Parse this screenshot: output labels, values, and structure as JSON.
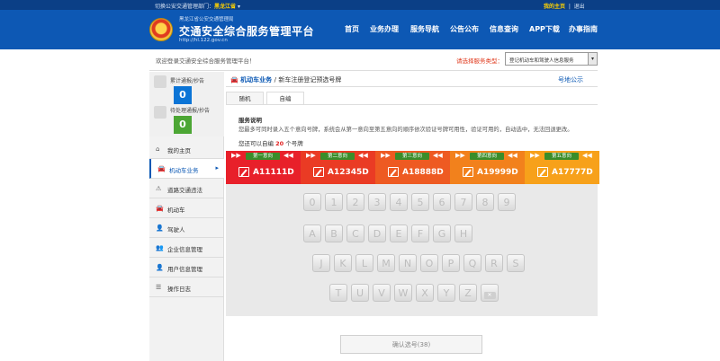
{
  "topbar": {
    "switch_text": "切换公安交通管理部门",
    "province": "黑龙江省",
    "login_link": "我的主页",
    "logout": "退出"
  },
  "header": {
    "bureau": "黑龙江省公安交通管理局",
    "title": "交通安全综合服务管理平台",
    "url": "http://hl.122.gov.cn",
    "nav": [
      "首页",
      "业务办理",
      "服务导航",
      "公告公布",
      "信息查询",
      "APP下载",
      "办事指南"
    ]
  },
  "welcome": {
    "text": "欢迎登录交通安全综合服务管理平台！",
    "service_label": "请选择服务类型：",
    "service_value": "登记机动车和驾驶人信息服务"
  },
  "stats": [
    {
      "label": "累计通报/抄告",
      "value": "0"
    },
    {
      "label": "待处理通报/抄告",
      "value": "0"
    }
  ],
  "sidebar": {
    "items": [
      {
        "label": "我的主页",
        "icon": "home-icon"
      },
      {
        "label": "机动车业务",
        "icon": "car-icon",
        "active": true
      },
      {
        "label": "道路交通违法",
        "icon": "warning-icon"
      },
      {
        "label": "机动车",
        "icon": "car-icon"
      },
      {
        "label": "驾驶人",
        "icon": "person-icon"
      },
      {
        "label": "企业信息管理",
        "icon": "users-icon"
      },
      {
        "label": "用户信息管理",
        "icon": "user-icon"
      },
      {
        "label": "操作日志",
        "icon": "log-icon"
      }
    ]
  },
  "breadcrumb": {
    "section": "机动车业务",
    "separator": "/",
    "page": "新车注册登记预选号牌",
    "help": "号地公示"
  },
  "tabs": [
    {
      "label": "随机"
    },
    {
      "label": "自编",
      "active": true
    }
  ],
  "description": {
    "title": "服务说明",
    "text": "您最多可同时录入五个意向号牌，系统会从第一意向至第五意向的顺序依次验证号牌可用性，验证可用的，自动选中，无法回退更改。",
    "remain_prefix": "您还可以自编",
    "remain_count": "20",
    "remain_suffix": "个号牌"
  },
  "plates": [
    {
      "label": "第一意向",
      "number": "A11111D",
      "color": "#e8202a"
    },
    {
      "label": "第二意向",
      "number": "A12345D",
      "color": "#ea3b24"
    },
    {
      "label": "第三意向",
      "number": "A18888D",
      "color": "#ee5a22"
    },
    {
      "label": "第四意向",
      "number": "A19999D",
      "color": "#f2811c"
    },
    {
      "label": "第五意向",
      "number": "A17777D",
      "color": "#f7a11a"
    }
  ],
  "keyboard": {
    "row1": [
      "0",
      "1",
      "2",
      "3",
      "4",
      "5",
      "6",
      "7",
      "8",
      "9"
    ],
    "row2": [
      "A",
      "B",
      "C",
      "D",
      "E",
      "F",
      "G",
      "H"
    ],
    "row3": [
      "J",
      "K",
      "L",
      "M",
      "N",
      "O",
      "P",
      "Q",
      "R",
      "S"
    ],
    "row4": [
      "T",
      "U",
      "V",
      "W",
      "X",
      "Y",
      "Z"
    ]
  },
  "confirm_button": "确认选号(38)"
}
